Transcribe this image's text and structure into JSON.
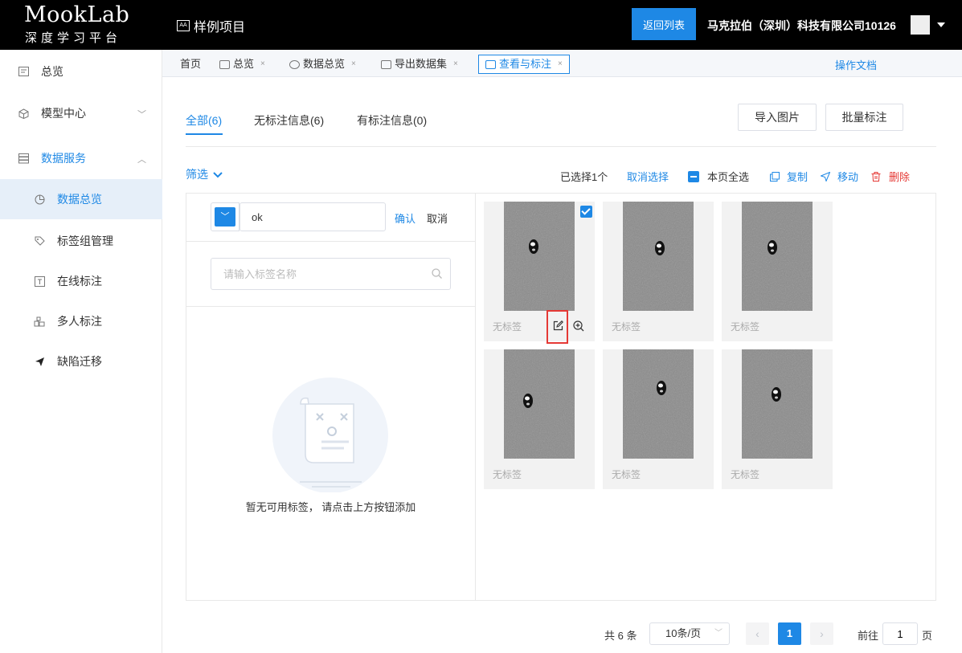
{
  "header": {
    "logo_title": "MookLab",
    "logo_subtitle": "深度学习平台",
    "project": "样例项目",
    "back_button": "返回列表",
    "company": "马克拉伯（深圳）科技有限公司10126"
  },
  "sidebar": {
    "items": [
      {
        "label": "总览"
      },
      {
        "label": "模型中心"
      },
      {
        "label": "数据服务"
      },
      {
        "label": "数据总览"
      },
      {
        "label": "标签组管理"
      },
      {
        "label": "在线标注"
      },
      {
        "label": "多人标注"
      },
      {
        "label": "缺陷迁移"
      }
    ]
  },
  "tabs": [
    {
      "label": "首页"
    },
    {
      "label": "总览"
    },
    {
      "label": "数据总览"
    },
    {
      "label": "导出数据集"
    },
    {
      "label": "查看与标注"
    }
  ],
  "docs_link": "操作文档",
  "filters": {
    "all": "全部(6)",
    "unlabeled": "无标注信息(6)",
    "labeled": "有标注信息(0)"
  },
  "actions": {
    "import": "导入图片",
    "batch": "批量标注"
  },
  "toolbar": {
    "filter": "筛选",
    "selected": "已选择1个",
    "cancel_select": "取消选择",
    "select_page": "本页全选",
    "copy": "复制",
    "move": "移动",
    "delete": "删除"
  },
  "left_panel": {
    "input_value": "ok",
    "confirm": "确认",
    "cancel": "取消",
    "search_placeholder": "请输入标签名称",
    "empty_text": "暂无可用标签， 请点击上方按钮添加"
  },
  "images": [
    {
      "label": "无标签",
      "selected": true
    },
    {
      "label": "无标签",
      "selected": false
    },
    {
      "label": "无标签",
      "selected": false
    },
    {
      "label": "无标签",
      "selected": false
    },
    {
      "label": "无标签",
      "selected": false
    },
    {
      "label": "无标签",
      "selected": false
    }
  ],
  "pagination": {
    "total": "共 6 条",
    "page_size": "10条/页",
    "current_page": "1",
    "goto_label": "前往",
    "goto_value": "1",
    "page_suffix": "页"
  },
  "colors": {
    "accent": "#1e88e5",
    "danger": "#e53935",
    "header_bg": "#000000"
  }
}
